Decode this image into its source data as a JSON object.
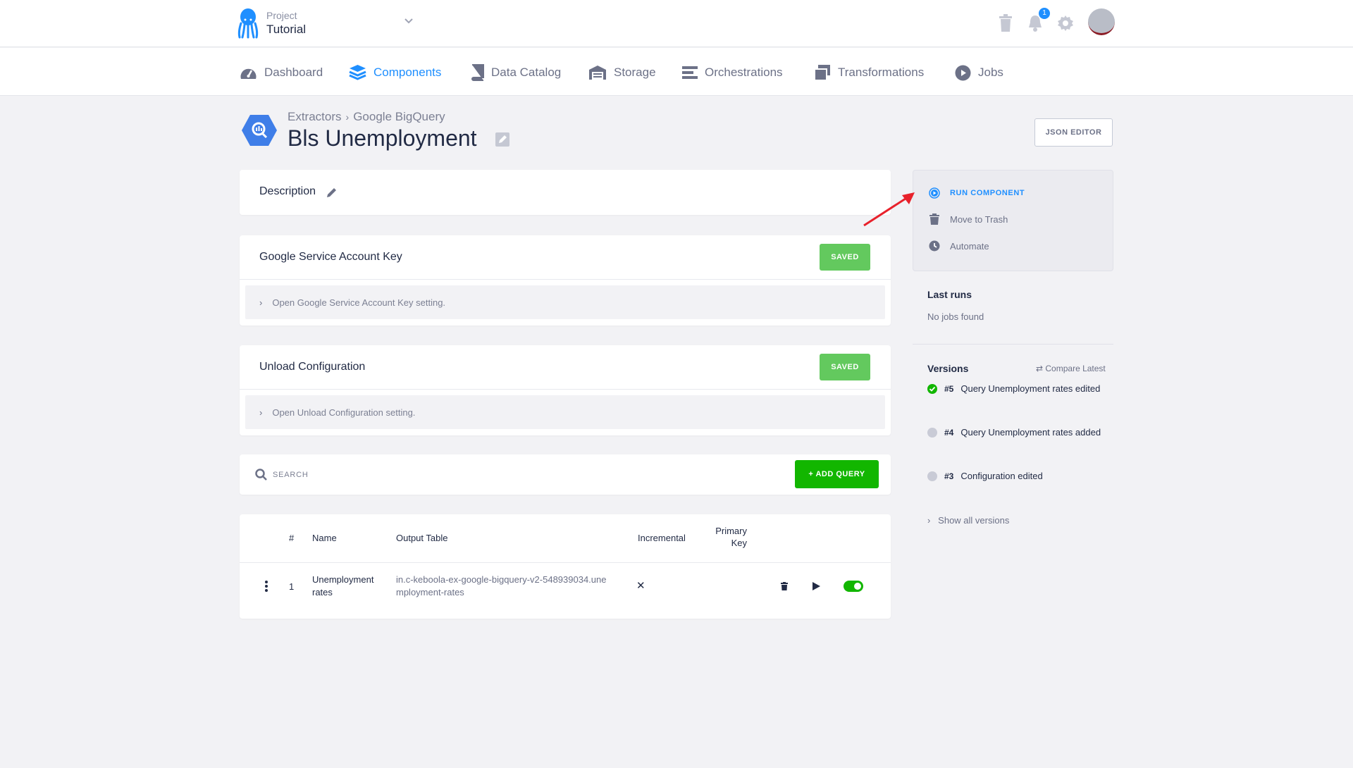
{
  "project": {
    "label": "Project",
    "name": "Tutorial"
  },
  "notifications": {
    "count": "1"
  },
  "nav": {
    "items": [
      {
        "label": "Dashboard",
        "icon": "dashboard-icon"
      },
      {
        "label": "Components",
        "icon": "layers-icon",
        "active": true
      },
      {
        "label": "Data Catalog",
        "icon": "book-icon"
      },
      {
        "label": "Storage",
        "icon": "warehouse-icon"
      },
      {
        "label": "Orchestrations",
        "icon": "bars-icon"
      },
      {
        "label": "Transformations",
        "icon": "window-stack-icon"
      },
      {
        "label": "Jobs",
        "icon": "play-circle-icon"
      }
    ]
  },
  "breadcrumb": {
    "first": "Extractors",
    "second": "Google BigQuery"
  },
  "page": {
    "title": "Bls Unemployment",
    "json_editor": "JSON EDITOR"
  },
  "description": {
    "label": "Description"
  },
  "service_key": {
    "title": "Google Service Account Key",
    "status": "SAVED",
    "open_text": "Open Google Service Account Key setting."
  },
  "unload": {
    "title": "Unload Configuration",
    "status": "SAVED",
    "open_text": "Open Unload Configuration setting."
  },
  "search": {
    "placeholder": "SEARCH",
    "add_label": "ADD QUERY"
  },
  "table": {
    "headers": {
      "num": "#",
      "name": "Name",
      "output": "Output Table",
      "incremental": "Incremental",
      "pk_line1": "Primary",
      "pk_line2": "Key"
    },
    "rows": [
      {
        "num": "1",
        "name_line1": "Unemployment",
        "name_line2": "rates",
        "output_line1": "in.c-keboola-ex-google-bigquery-v2-548939034.une",
        "output_line2": "mployment-rates",
        "incremental": "✕",
        "enabled": true
      }
    ]
  },
  "sidebar": {
    "run": "RUN COMPONENT",
    "trash": "Move to Trash",
    "automate": "Automate",
    "last_runs_title": "Last runs",
    "last_runs_empty": "No jobs found",
    "versions_title": "Versions",
    "compare": "Compare Latest",
    "versions": [
      {
        "num": "#5",
        "text": "Query Unemployment rates edited",
        "current": true
      },
      {
        "num": "#4",
        "text": "Query Unemployment rates added",
        "current": false
      },
      {
        "num": "#3",
        "text": "Configuration edited",
        "current": false
      }
    ],
    "show_all": "Show all versions"
  },
  "colors": {
    "accent": "#1f8fff",
    "saved": "#63c95e",
    "add": "#12b600",
    "arrow": "#e8212b"
  }
}
